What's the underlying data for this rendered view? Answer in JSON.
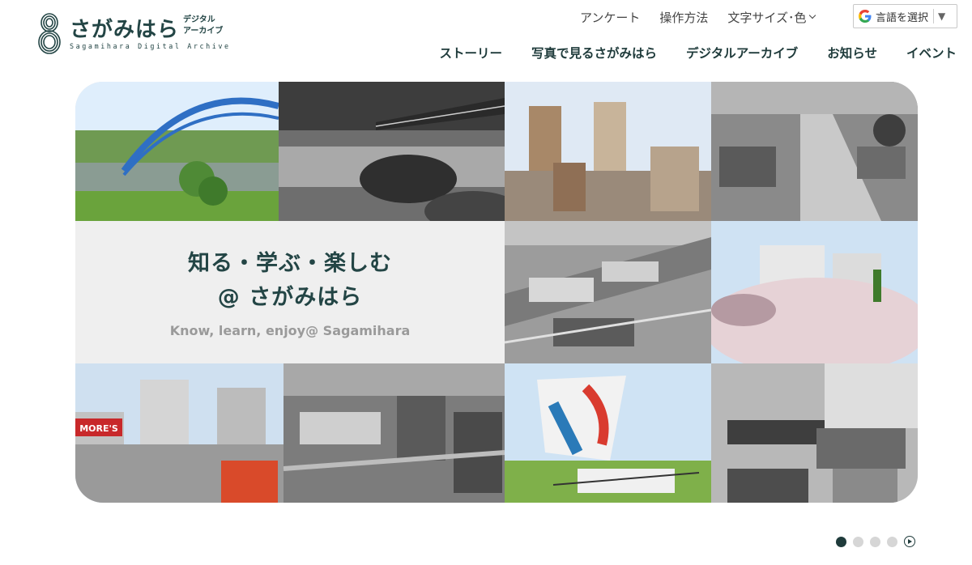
{
  "header": {
    "logo": {
      "title": "さがみはら",
      "sub_line1": "デジタル",
      "sub_line2": "アーカイブ",
      "english": "Sagamihara Digital Archive"
    },
    "utility_nav": {
      "survey": "アンケート",
      "howto": "操作方法",
      "font_size_color": "文字サイズ･色"
    },
    "translate": {
      "label": "言語を選択",
      "arrow": "▼",
      "icon": "google-g-icon"
    },
    "main_nav": [
      "ストーリー",
      "写真で見るさがみはら",
      "デジタルアーカイブ",
      "お知らせ",
      "イベント"
    ]
  },
  "hero": {
    "line1": "知る・学ぶ・楽しむ",
    "line2": "@ さがみはら",
    "english": "Know, learn, enjoy@ Sagamihara",
    "photo_banner_text": "MORE'S"
  },
  "pager": {
    "slides": 4,
    "active_index": 0,
    "play_icon": "play-icon"
  },
  "colors": {
    "brand": "#234545",
    "nav_text": "#1f3b3b",
    "panel_bg": "#efefef",
    "subtitle": "#9a9a9a"
  }
}
